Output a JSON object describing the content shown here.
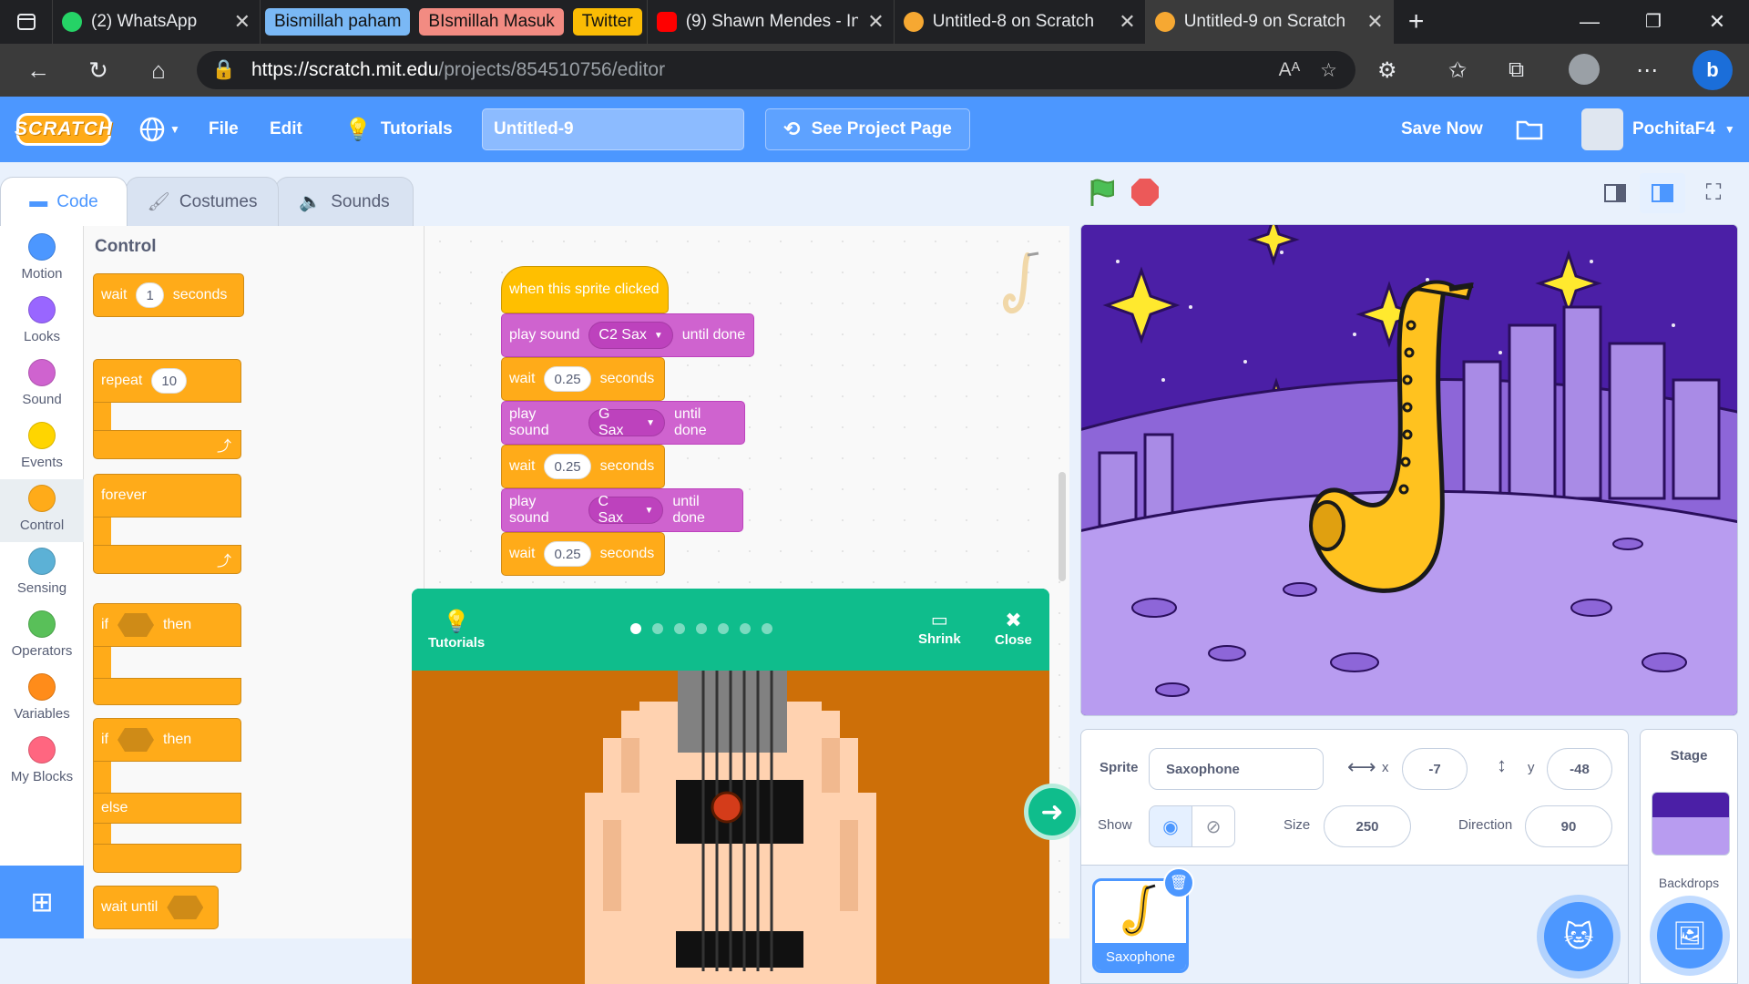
{
  "browser": {
    "tabs": [
      {
        "label": "(2) WhatsApp",
        "icon": "whatsapp-icon"
      },
      {
        "label": "Bismillah paham",
        "pill_color": "#7ab8f5"
      },
      {
        "label": "BIsmillah Masuk",
        "pill_color": "#f28b82"
      },
      {
        "label": "Twitter",
        "pill_color": "#fbbc04"
      },
      {
        "label": "(9) Shawn Mendes - In",
        "icon": "youtube-icon"
      },
      {
        "label": "Untitled-8 on Scratch",
        "icon": "scratch-icon"
      },
      {
        "label": "Untitled-9 on Scratch",
        "icon": "scratch-icon",
        "active": true
      }
    ],
    "url_host": "https://scratch.mit.edu",
    "url_path": "/projects/854510756/editor"
  },
  "menubar": {
    "logo": "SCRATCH",
    "file": "File",
    "edit": "Edit",
    "tutorials": "Tutorials",
    "project_title": "Untitled-9",
    "see_project": "See Project Page",
    "save_now": "Save Now",
    "username": "PochitaF4"
  },
  "editor_tabs": {
    "code": "Code",
    "costumes": "Costumes",
    "sounds": "Sounds"
  },
  "categories": [
    {
      "label": "Motion",
      "color": "#4c97ff"
    },
    {
      "label": "Looks",
      "color": "#9966ff"
    },
    {
      "label": "Sound",
      "color": "#cf63cf"
    },
    {
      "label": "Events",
      "color": "#ffd500"
    },
    {
      "label": "Control",
      "color": "#ffab19"
    },
    {
      "label": "Sensing",
      "color": "#5cb1d6"
    },
    {
      "label": "Operators",
      "color": "#59c059"
    },
    {
      "label": "Variables",
      "color": "#ff8c1a"
    },
    {
      "label": "My Blocks",
      "color": "#ff6680"
    }
  ],
  "palette": {
    "heading": "Control",
    "wait_label": "wait",
    "wait_value": "1",
    "wait_unit": "seconds",
    "repeat_label": "repeat",
    "repeat_value": "10",
    "forever_label": "forever",
    "if_label": "if",
    "then_label": "then",
    "else_label": "else",
    "wait_until_label": "wait until"
  },
  "script": {
    "hat": "when this sprite clicked",
    "play_sound": "play sound",
    "until_done": "until done",
    "wait": "wait",
    "seconds": "seconds",
    "sound1": "C2 Sax",
    "sound2": "G Sax",
    "sound3": "C Sax",
    "wait1": "0.25",
    "wait2": "0.25",
    "wait3": "0.25"
  },
  "tutorial": {
    "tutorials_label": "Tutorials",
    "shrink_label": "Shrink",
    "close_label": "Close",
    "total_steps": 7,
    "current_step": 1
  },
  "sprite_info": {
    "sprite_label": "Sprite",
    "sprite_name": "Saxophone",
    "x_label": "x",
    "x_value": "-7",
    "y_label": "y",
    "y_value": "-48",
    "show_label": "Show",
    "size_label": "Size",
    "size_value": "250",
    "direction_label": "Direction",
    "direction_value": "90"
  },
  "sprite_list": [
    {
      "name": "Saxophone"
    }
  ],
  "stage_pane": {
    "title": "Stage",
    "backdrops_label": "Backdrops"
  }
}
